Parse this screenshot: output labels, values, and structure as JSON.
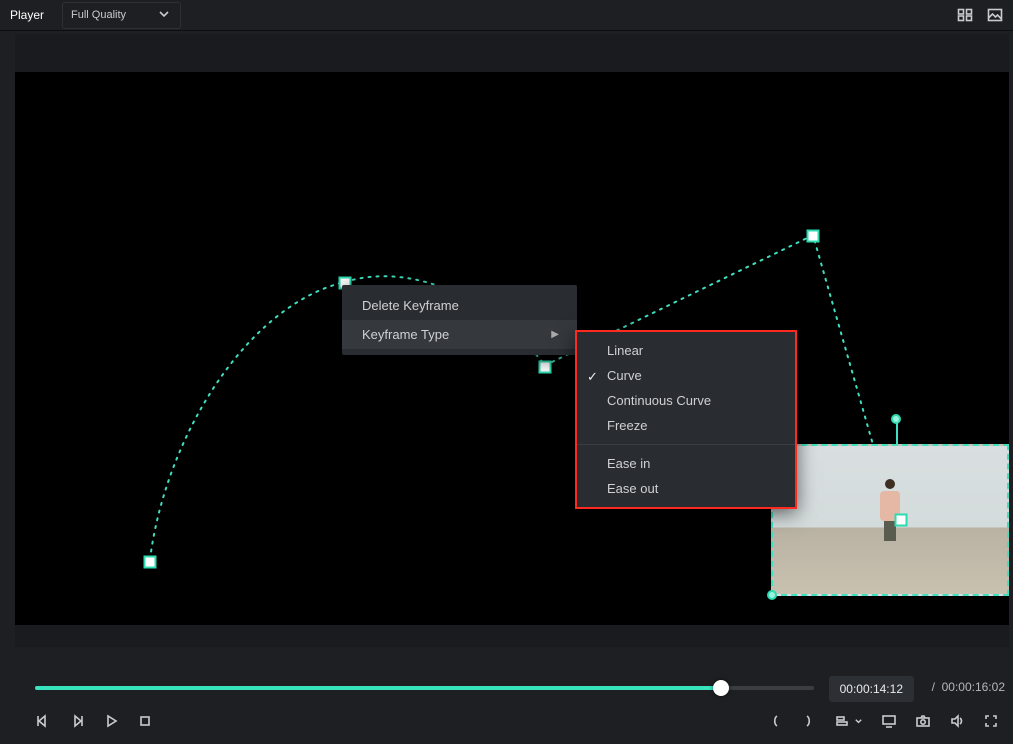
{
  "header": {
    "title_label": "Player",
    "quality_selected": "Full Quality"
  },
  "context_menu": {
    "delete_label": "Delete Keyframe",
    "type_label": "Keyframe Type"
  },
  "submenu": {
    "linear": "Linear",
    "curve": "Curve",
    "continuous": "Continuous Curve",
    "freeze": "Freeze",
    "ease_in": "Ease in",
    "ease_out": "Ease out",
    "selected": "curve"
  },
  "timeline": {
    "progress_percent": 88,
    "current": "00:00:14:12",
    "separator": "/",
    "total": "00:00:16:02"
  },
  "colors": {
    "accent": "#38e4be"
  }
}
